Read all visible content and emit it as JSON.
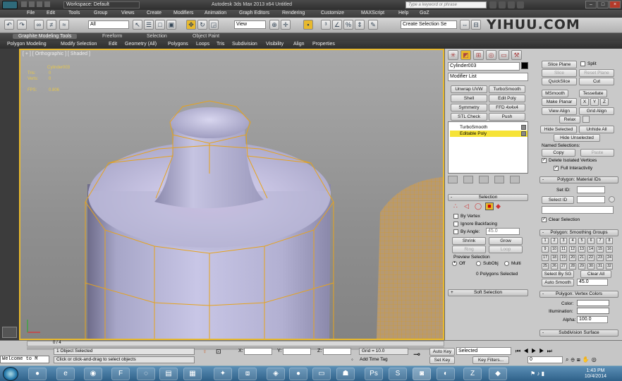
{
  "titlebar": {
    "workspace": "Workspace: Default",
    "title": "Autodesk 3ds Max  2013 x64        Untitled",
    "search_placeholder": "Type a keyword or phrase",
    "window_buttons": [
      "–",
      "□",
      "×"
    ]
  },
  "menu": [
    "File",
    "Edit",
    "Tools",
    "Group",
    "Views",
    "Create",
    "Modifiers",
    "Animation",
    "Graph Editors",
    "Rendering",
    "Customize",
    "MAXScript",
    "Help",
    "GoZ"
  ],
  "toolbar": {
    "selection_filter": "All",
    "ref_coord": "View",
    "named_selection_placeholder": "Create Selection Se",
    "watermark": "YIHUU.COM"
  },
  "ribbon": {
    "tabs": [
      "Graphite Modeling Tools",
      "Freeform",
      "Selection",
      "Object Paint"
    ],
    "sub": [
      "Polygon Modeling",
      "Modify Selection",
      "Edit",
      "Geometry (All)",
      "Polygons",
      "Loops",
      "Tris",
      "Subdivision",
      "Visibility",
      "Align",
      "Properties"
    ]
  },
  "viewport": {
    "label": "[ + ] [ Orthographic ] [ Shaded ]",
    "object_name": "Cylinder003",
    "stats": [
      {
        "label": "Tris:",
        "value": "0"
      },
      {
        "label": "Verts:",
        "value": "0"
      },
      {
        "label": "FPS:",
        "value": "0.806"
      }
    ]
  },
  "command_panel": {
    "object_name": "Cylinder003",
    "modifier_list": "Modifier List",
    "modifier_buttons": [
      "Unwrap UVW",
      "TurboSmooth",
      "Shell",
      "Edit Poly",
      "Symmetry",
      "FFD 4x4x4",
      "STL Check",
      "Push"
    ],
    "stack": [
      "TurboSmooth",
      "Editable Poly"
    ],
    "selection": {
      "title": "Selection",
      "by_vertex": "By Vertex",
      "ignore_backfacing": "Ignore Backfacing",
      "by_angle": "By Angle:",
      "angle_value": "45.0",
      "shrink": "Shrink",
      "grow": "Grow",
      "ring": "Ring",
      "loop": "Loop",
      "preview_title": "Preview Selection",
      "preview_off": "Off",
      "preview_subobj": "SubObj",
      "preview_multi": "Multi",
      "status": "0 Polygons Selected"
    },
    "soft_selection": "Soft Selection",
    "edit_geometry": {
      "slice_plane": "Slice Plane",
      "split": "Split",
      "slice": "Slice",
      "reset_plane": "Reset Plane",
      "quickslice": "QuickSlice",
      "cut": "Cut",
      "msmooth": "MSmooth",
      "tessellate": "Tessellate",
      "make_planar": "Make Planar",
      "x": "X",
      "y": "Y",
      "z": "Z",
      "view_align": "View Align",
      "grid_align": "Grid Align",
      "relax": "Relax",
      "hide_selected": "Hide Selected",
      "unhide_all": "Unhide All",
      "hide_unselected": "Hide Unselected",
      "named_selections": "Named Selections:",
      "copy": "Copy",
      "paste": "Paste",
      "delete_isolated": "Delete Isolated Vertices",
      "full_interactivity": "Full Interactivity"
    },
    "material_ids": {
      "title": "Polygon: Material IDs",
      "set_id": "Set ID:",
      "select_id": "Select ID",
      "clear_selection": "Clear Selection"
    },
    "smoothing_groups": {
      "title": "Polygon: Smoothing Groups",
      "groups": [
        "1",
        "2",
        "3",
        "4",
        "5",
        "6",
        "7",
        "8",
        "9",
        "10",
        "11",
        "12",
        "13",
        "14",
        "15",
        "16",
        "17",
        "18",
        "19",
        "20",
        "21",
        "22",
        "23",
        "24",
        "25",
        "26",
        "27",
        "28",
        "29",
        "30",
        "31",
        "32"
      ],
      "select_by_sg": "Select By SG",
      "clear_all": "Clear All",
      "auto_smooth": "Auto Smooth",
      "auto_smooth_value": "45.0"
    },
    "vertex_colors": {
      "title": "Polygon: Vertex Colors",
      "color": "Color:",
      "illumination": "Illumination:",
      "alpha": "Alpha:",
      "alpha_value": "100.0"
    },
    "subdivision_surface": "Subdivision Surface"
  },
  "bottom": {
    "frame": "0 / 4",
    "maxscript": "Welcome to M",
    "status1": "1 Object Selected",
    "status2": "Click or click-and-drag to select objects",
    "x_label": "X:",
    "y_label": "Y:",
    "z_label": "Z:",
    "grid": "Grid = 10.0",
    "add_time_tag": "Add Time Tag",
    "auto_key": "Auto Key",
    "set_key": "Set Key",
    "key_mode": "Selected",
    "key_filters": "Key Filters...",
    "frame_field": "0"
  },
  "taskbar": {
    "time": "1:43 PM",
    "date": "10/4/2014"
  },
  "colors": {
    "viewport_border": "#e8b92d",
    "wire": "#e6a31e",
    "stack_selected": "#f6e337"
  }
}
